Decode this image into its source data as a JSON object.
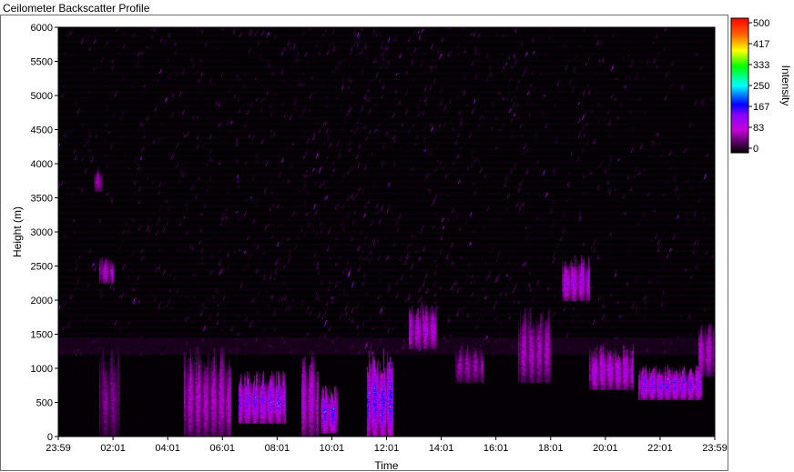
{
  "window": {
    "title": "Ceilometer Backscatter Profile"
  },
  "chart_data": {
    "type": "heatmap",
    "title": "",
    "xlabel": "Time",
    "ylabel": "Height (m)",
    "colorbar_label": "Intensity",
    "x_ticks": [
      "23:59",
      "02:01",
      "04:01",
      "06:01",
      "08:01",
      "10:01",
      "12:01",
      "14:01",
      "16:01",
      "18:01",
      "20:01",
      "22:01",
      "23:59"
    ],
    "x_range_hours": [
      0,
      24
    ],
    "ylim": [
      0,
      6000
    ],
    "y_ticks": [
      0,
      500,
      1000,
      1500,
      2000,
      2500,
      3000,
      3500,
      4000,
      4500,
      5000,
      5500,
      6000
    ],
    "colorbar_range": [
      0,
      500
    ],
    "colorbar_ticks": [
      "500",
      "417",
      "333",
      "250",
      "167",
      "83",
      "0"
    ],
    "colormap": [
      "#000000",
      "#5a0066",
      "#c400d8",
      "#8a00ff",
      "#0000ff",
      "#00ffff",
      "#00ff00",
      "#ffff00",
      "#ff6000",
      "#ff0000"
    ],
    "grid": false,
    "layers": {
      "noise_zone_max_height": 6000,
      "noise_density_peak_time": 11,
      "mixing_layer_top": 1200,
      "residual_layer_top": 1450
    },
    "features": [
      {
        "start": 1.5,
        "end": 2.2,
        "base": 0,
        "top": 1200,
        "intensity": 90
      },
      {
        "start": 4.6,
        "end": 6.3,
        "base": 0,
        "top": 1200,
        "intensity": 130
      },
      {
        "start": 6.6,
        "end": 8.3,
        "base": 200,
        "top": 900,
        "intensity": 200
      },
      {
        "start": 8.9,
        "end": 9.5,
        "base": 0,
        "top": 1100,
        "intensity": 150
      },
      {
        "start": 9.6,
        "end": 10.2,
        "base": 50,
        "top": 700,
        "intensity": 220
      },
      {
        "start": 11.3,
        "end": 12.2,
        "base": 0,
        "top": 1200,
        "intensity": 230
      },
      {
        "start": 12.8,
        "end": 13.8,
        "base": 1300,
        "top": 1900,
        "intensity": 150
      },
      {
        "start": 14.5,
        "end": 15.5,
        "base": 800,
        "top": 1300,
        "intensity": 110
      },
      {
        "start": 16.8,
        "end": 18.0,
        "base": 800,
        "top": 1800,
        "intensity": 120
      },
      {
        "start": 18.4,
        "end": 19.4,
        "base": 2000,
        "top": 2600,
        "intensity": 170
      },
      {
        "start": 19.4,
        "end": 21.0,
        "base": 700,
        "top": 1300,
        "intensity": 160
      },
      {
        "start": 21.2,
        "end": 23.5,
        "base": 550,
        "top": 1000,
        "intensity": 200
      },
      {
        "start": 1.3,
        "end": 1.6,
        "base": 3600,
        "top": 3900,
        "intensity": 110
      },
      {
        "start": 1.5,
        "end": 2.0,
        "base": 2250,
        "top": 2600,
        "intensity": 140
      },
      {
        "start": 23.4,
        "end": 24.0,
        "base": 900,
        "top": 1600,
        "intensity": 140
      }
    ]
  }
}
